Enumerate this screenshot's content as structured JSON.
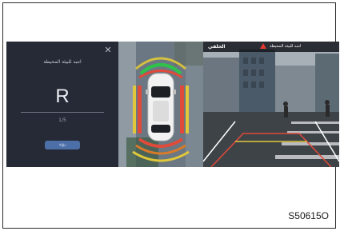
{
  "dialog": {
    "title": "انتبه للبيئة المحيطة",
    "gear": "R",
    "page_indicator": "1/5",
    "button_label": "رؤية",
    "close_icon": "close-icon"
  },
  "camera": {
    "view_label": "الخلفي",
    "warning_text": "انتبه للبيئة المحيطة",
    "warning_icon": "warning-triangle-icon",
    "warning_color": "#e23b2e"
  },
  "figure_code": "S50615O"
}
